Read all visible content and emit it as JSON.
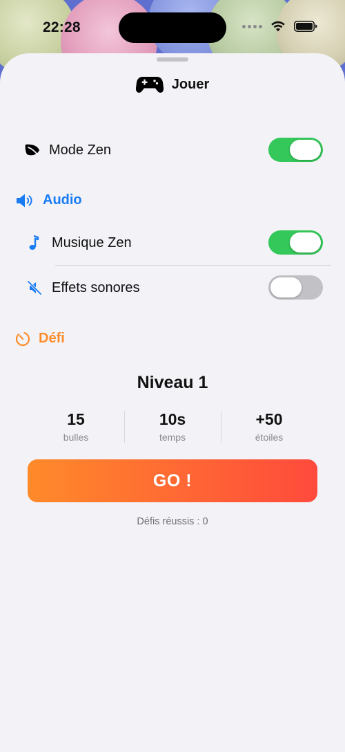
{
  "status_bar": {
    "time": "22:28"
  },
  "sheet": {
    "title": "Jouer",
    "zen_mode": {
      "label": "Mode Zen",
      "enabled": true
    },
    "audio": {
      "section_title": "Audio",
      "music": {
        "label": "Musique Zen",
        "enabled": true
      },
      "sound_effects": {
        "label": "Effets sonores",
        "enabled": false
      }
    },
    "challenge": {
      "section_title": "Défi",
      "level_title": "Niveau 1",
      "stats": [
        {
          "value": "15",
          "label": "bulles"
        },
        {
          "value": "10s",
          "label": "temps"
        },
        {
          "value": "+50",
          "label": "étoiles"
        }
      ],
      "go_label": "GO !",
      "completed_text": "Défis réussis : 0"
    }
  },
  "colors": {
    "accent_blue": "#1a7cf5",
    "accent_orange": "#ff8c2a",
    "toggle_on": "#34c759",
    "toggle_off": "#c2c2c6",
    "go_gradient_start": "#ff8a2a",
    "go_gradient_end": "#ff4a3c"
  },
  "icons": {
    "header": "gamecontroller-icon",
    "zen": "leaf-icon",
    "audio": "speaker-wave-icon",
    "music": "music-note-icon",
    "sound_effects": "speaker-slash-icon",
    "challenge": "timer-icon"
  }
}
